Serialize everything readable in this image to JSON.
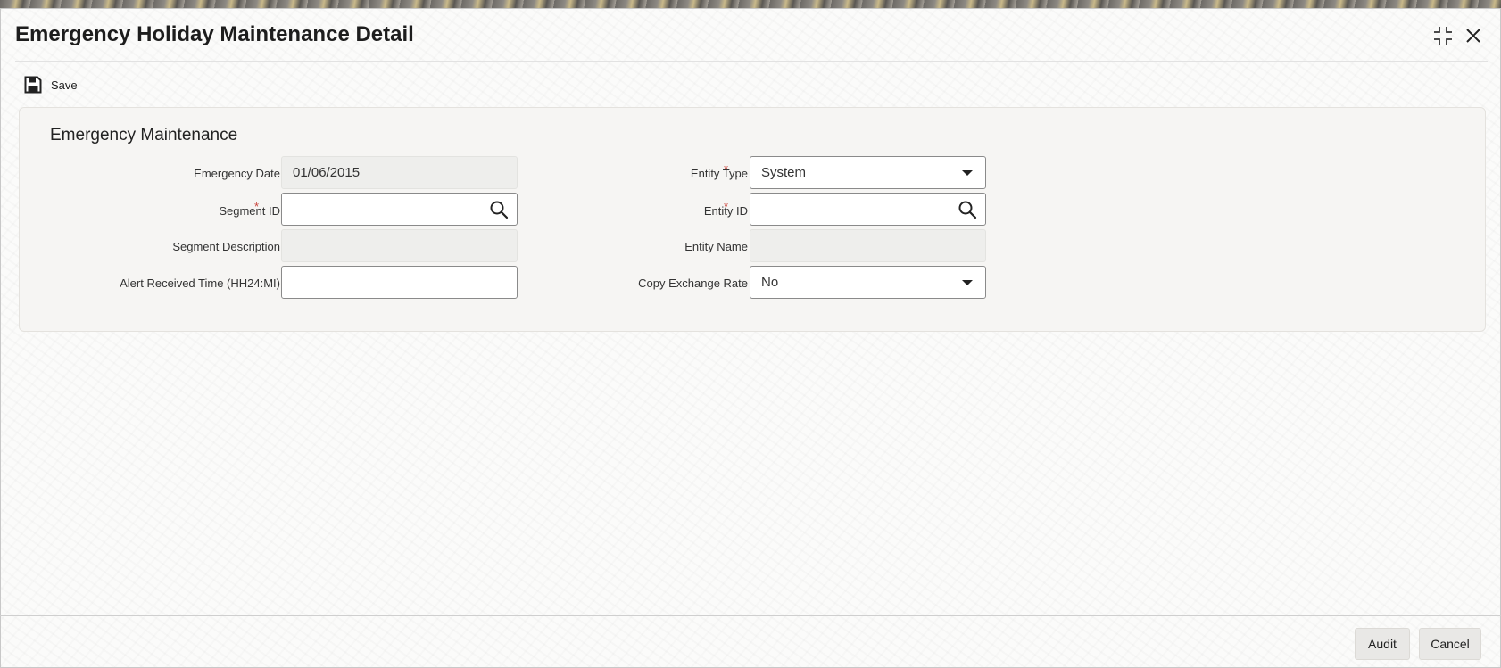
{
  "window": {
    "title": "Emergency Holiday Maintenance Detail"
  },
  "icons": {
    "maximize": "maximize-icon",
    "close": "close-icon",
    "save": "save-icon",
    "search": "search-icon",
    "dropdown": "chevron-down-icon"
  },
  "toolbar": {
    "save_label": "Save"
  },
  "section": {
    "title": "Emergency Maintenance"
  },
  "form": {
    "emergency_date": {
      "label": "Emergency Date",
      "value": "01/06/2015"
    },
    "segment_id": {
      "label": "Segment ID",
      "value": "",
      "required_mark": "*"
    },
    "segment_description": {
      "label": "Segment Description",
      "value": ""
    },
    "alert_received_time": {
      "label": "Alert Received Time (HH24:MI)",
      "value": ""
    },
    "entity_type": {
      "label": "Entity Type",
      "selected": "System",
      "required_mark": "*"
    },
    "entity_id": {
      "label": "Entity ID",
      "value": "",
      "required_mark": "*"
    },
    "entity_name": {
      "label": "Entity Name",
      "value": ""
    },
    "copy_exchange_rate": {
      "label": "Copy Exchange Rate",
      "selected": "No"
    }
  },
  "footer": {
    "audit_label": "Audit",
    "cancel_label": "Cancel"
  },
  "colors": {
    "required": "#c9433b",
    "panel_bg": "#f6f5f3",
    "readonly_bg": "#eeeeec"
  }
}
